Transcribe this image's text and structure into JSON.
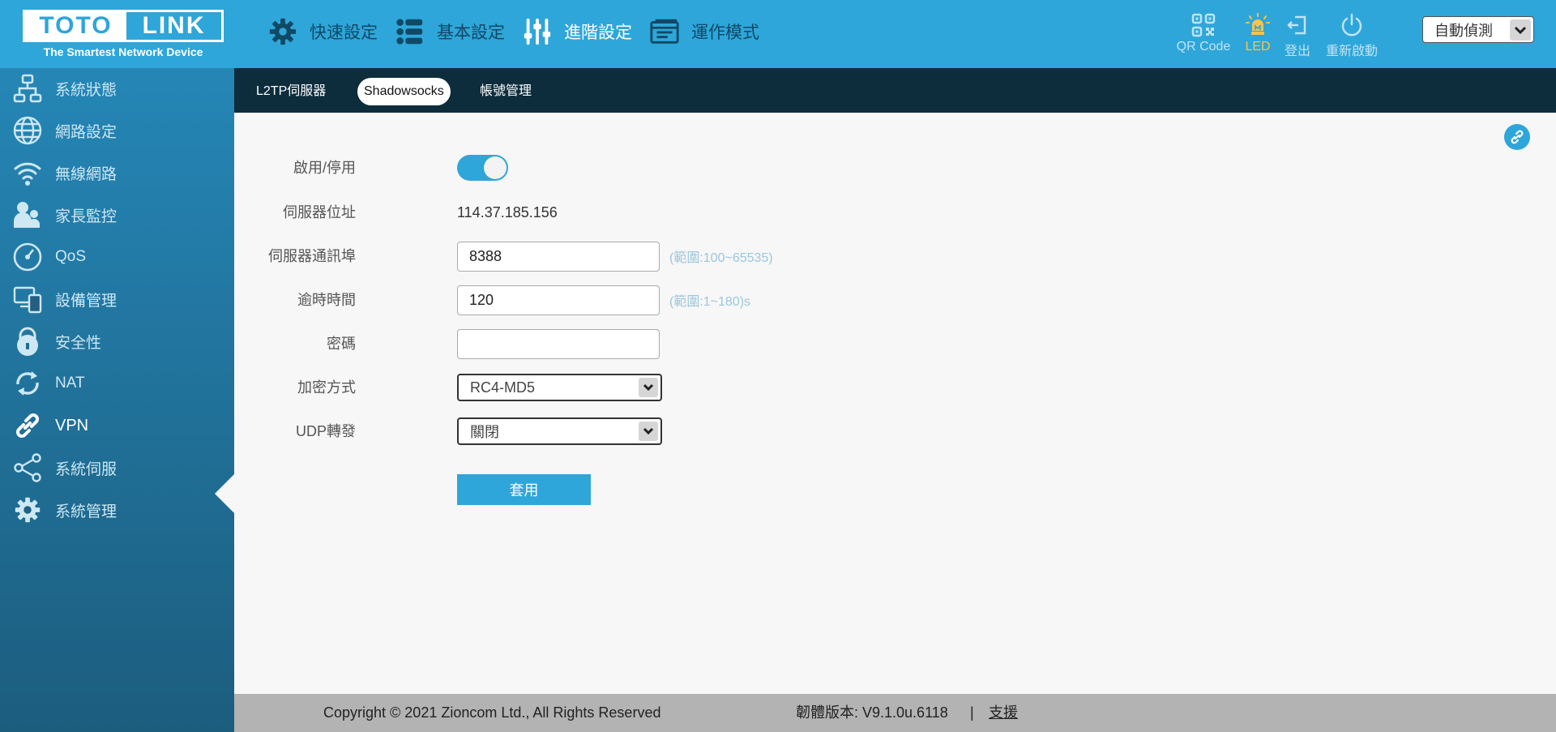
{
  "brand": {
    "logo_left": "TOTO",
    "logo_right": "LINK",
    "tagline": "The Smartest Network Device"
  },
  "topnav": [
    {
      "label": "快速設定",
      "icon": "gear-icon"
    },
    {
      "label": "基本設定",
      "icon": "list-icon"
    },
    {
      "label": "進階設定",
      "icon": "sliders-icon",
      "active": true
    },
    {
      "label": "運作模式",
      "icon": "mode-icon"
    }
  ],
  "tools": {
    "qrcode": "QR Code",
    "led": "LED",
    "logout": "登出",
    "reboot": "重新啟動"
  },
  "language": {
    "selected": "自動偵測"
  },
  "sidebar": {
    "items": [
      {
        "label": "系統狀態",
        "icon": "network-status-icon"
      },
      {
        "label": "網路設定",
        "icon": "globe-icon"
      },
      {
        "label": "無線網路",
        "icon": "wifi-icon"
      },
      {
        "label": "家長監控",
        "icon": "parental-icon"
      },
      {
        "label": "QoS",
        "icon": "speedometer-icon"
      },
      {
        "label": "設備管理",
        "icon": "devices-icon"
      },
      {
        "label": "安全性",
        "icon": "lock-icon"
      },
      {
        "label": "NAT",
        "icon": "refresh-icon"
      },
      {
        "label": "VPN",
        "icon": "link-icon",
        "active": true
      },
      {
        "label": "系統伺服",
        "icon": "share-icon"
      },
      {
        "label": "系統管理",
        "icon": "gear-icon"
      }
    ]
  },
  "subtabs": [
    {
      "label": "L2TP伺服器"
    },
    {
      "label": "Shadowsocks",
      "active": true
    },
    {
      "label": "帳號管理"
    }
  ],
  "form": {
    "enable": {
      "label": "啟用/停用",
      "state": "on"
    },
    "server_address": {
      "label": "伺服器位址",
      "value": "114.37.185.156"
    },
    "server_port": {
      "label": "伺服器通訊埠",
      "value": "8388",
      "hint": "(範圍:100~65535)"
    },
    "timeout": {
      "label": "逾時時間",
      "value": "120",
      "hint": "(範圍:1~180)s"
    },
    "password": {
      "label": "密碼",
      "value": ""
    },
    "encryption": {
      "label": "加密方式",
      "value": "RC4-MD5"
    },
    "udp_forward": {
      "label": "UDP轉發",
      "value": "關閉"
    },
    "apply_label": "套用"
  },
  "footer": {
    "copyright": "Copyright © 2021 Zioncom Ltd., All Rights Reserved",
    "firmware": "韌體版本: V9.1.0u.6118",
    "separator": "|",
    "support": "支援"
  },
  "colors": {
    "header": "#2ea6d9",
    "sidebar_top": "#2586b6",
    "sidebar_bottom": "#1c5d7e",
    "subtab_bar": "#0d2d3c",
    "accent": "#2ea6d9",
    "led": "#ffc24a"
  }
}
